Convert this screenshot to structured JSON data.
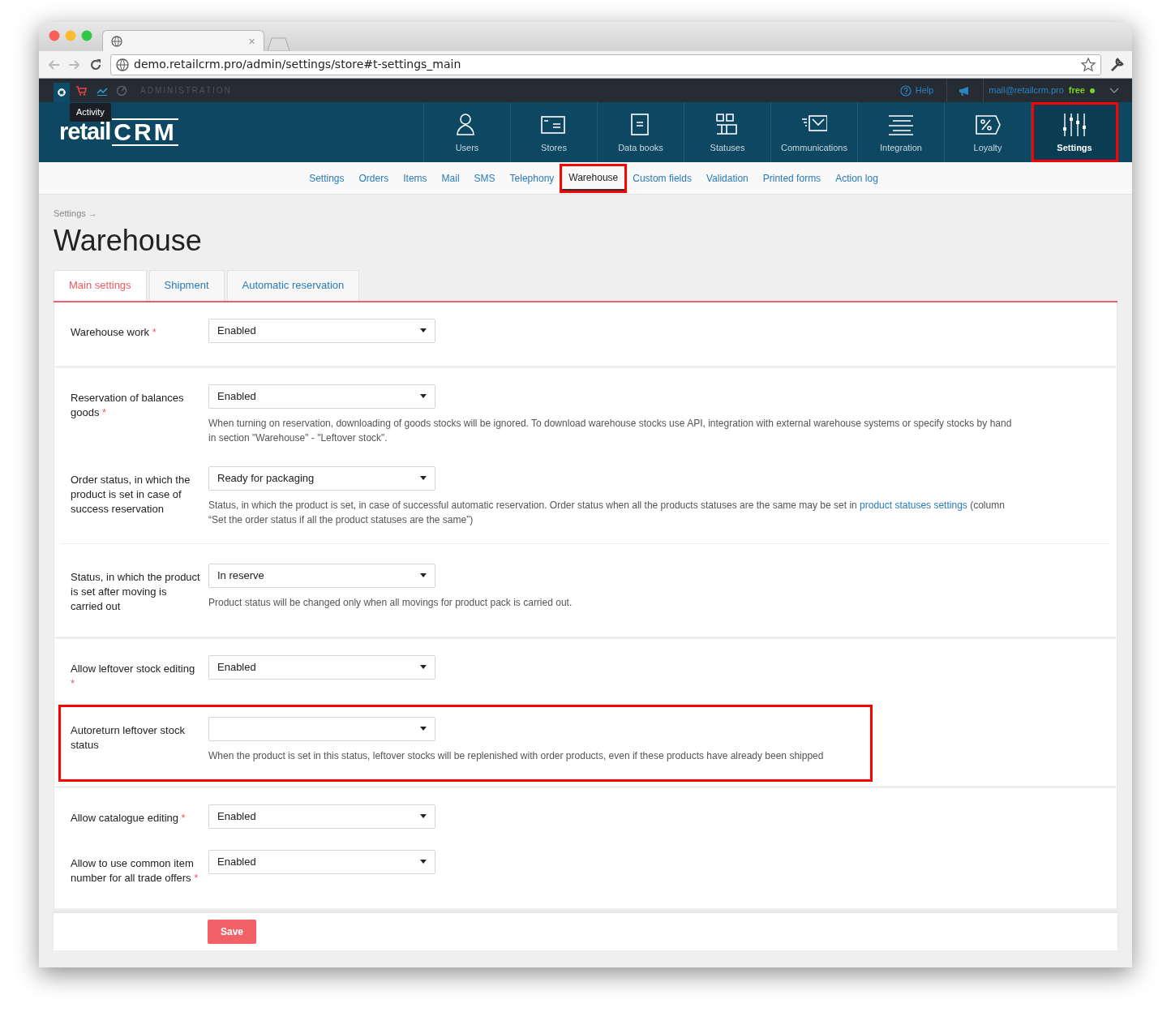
{
  "browser": {
    "tab_close": "×",
    "url": "demo.retailcrm.pro/admin/settings/store#t-settings_main"
  },
  "top_bar": {
    "section_label": "ADMINISTRATION",
    "tooltip": "Activity",
    "help": "Help",
    "email": "mail@retailcrm.pro",
    "plan": "free"
  },
  "logo": {
    "word": "retail",
    "mark": "CRM"
  },
  "main_nav": [
    {
      "label": "Users",
      "selected": false,
      "highlighted": false
    },
    {
      "label": "Stores",
      "selected": false,
      "highlighted": false
    },
    {
      "label": "Data books",
      "selected": false,
      "highlighted": false
    },
    {
      "label": "Statuses",
      "selected": false,
      "highlighted": false
    },
    {
      "label": "Communications",
      "selected": false,
      "highlighted": false
    },
    {
      "label": "Integration",
      "selected": false,
      "highlighted": false
    },
    {
      "label": "Loyalty",
      "selected": false,
      "highlighted": false
    },
    {
      "label": "Settings",
      "selected": true,
      "highlighted": true
    }
  ],
  "sub_nav": [
    {
      "label": "Settings",
      "selected": false,
      "highlighted": false
    },
    {
      "label": "Orders",
      "selected": false,
      "highlighted": false
    },
    {
      "label": "Items",
      "selected": false,
      "highlighted": false
    },
    {
      "label": "Mail",
      "selected": false,
      "highlighted": false
    },
    {
      "label": "SMS",
      "selected": false,
      "highlighted": false
    },
    {
      "label": "Telephony",
      "selected": false,
      "highlighted": false
    },
    {
      "label": "Warehouse",
      "selected": true,
      "highlighted": true
    },
    {
      "label": "Custom fields",
      "selected": false,
      "highlighted": false
    },
    {
      "label": "Validation",
      "selected": false,
      "highlighted": false
    },
    {
      "label": "Printed forms",
      "selected": false,
      "highlighted": false
    },
    {
      "label": "Action log",
      "selected": false,
      "highlighted": false
    }
  ],
  "breadcrumb": "Settings →",
  "page_title": "Warehouse",
  "tabs": [
    {
      "label": "Main settings",
      "selected": true
    },
    {
      "label": "Shipment",
      "selected": false
    },
    {
      "label": "Automatic reservation",
      "selected": false
    }
  ],
  "sections": [
    {
      "fields": [
        {
          "label": "Warehouse work",
          "required_mark": "*",
          "value": "Enabled",
          "highlighted": false
        }
      ]
    },
    {
      "fields": [
        {
          "label": "Reservation of balances goods",
          "required_mark": "*",
          "value": "Enabled",
          "hint": [
            "When turning on reservation, downloading of goods stocks will be ignored. To download warehouse stocks use API, integration with external warehouse systems or specify stocks by hand in section \"Warehouse\" - \"Leftover stock\"."
          ],
          "highlighted": false
        },
        {
          "label": "Order status, in which the product is set in case of success reservation",
          "value": "Ready for packaging",
          "hint": [
            "Status, in which the product is set, in case of successful automatic reservation. Order status when all the products statuses are the same may be set in ",
            "product statuses settings",
            " (column “Set the order status if all the product statuses are the same”)"
          ],
          "highlighted": false
        },
        {
          "label": "Status, in which the product is set after moving is carried out",
          "value": "In reserve",
          "hint": [
            "Product status will be changed only when all movings for product pack is carried out."
          ],
          "highlighted": false,
          "divider": true
        }
      ]
    },
    {
      "fields": [
        {
          "label": "Allow leftover stock editing",
          "required_mark": "*",
          "value": "Enabled",
          "highlighted": false
        },
        {
          "label": "Autoreturn leftover stock status",
          "hint": [
            "When the product is set in this status, leftover stocks will be replenished with order products, even if these products have already been shipped"
          ],
          "highlighted": true
        }
      ]
    },
    {
      "fields": [
        {
          "label": "Allow catalogue editing",
          "required_mark": "*",
          "value": "Enabled",
          "highlighted": false
        },
        {
          "label": "Allow to use common item number for all trade offers",
          "required_mark": "*",
          "value": "Enabled",
          "highlighted": false
        }
      ]
    }
  ],
  "save_button": "Save"
}
